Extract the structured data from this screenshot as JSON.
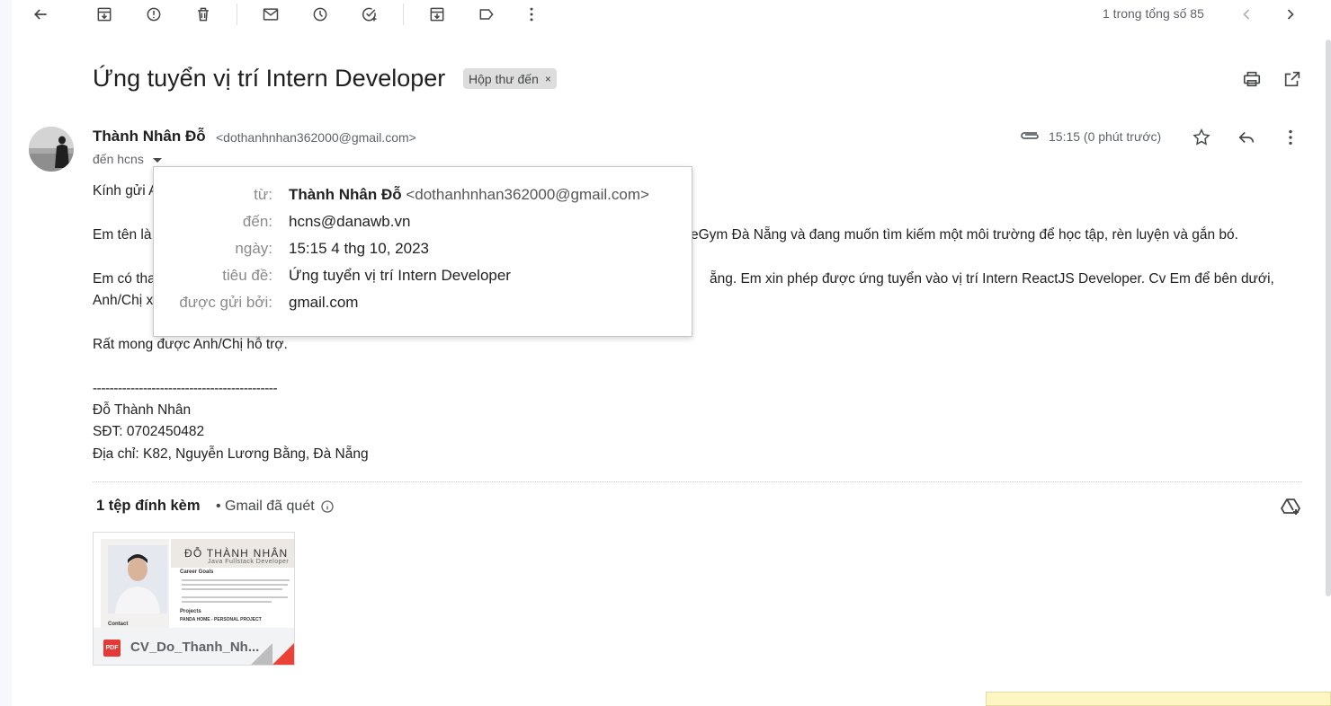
{
  "toolbar": {
    "back": "back-arrow-icon",
    "pager_text": "1 trong tổng số 85"
  },
  "subject": {
    "title": "Ứng tuyển vị trí Intern Developer",
    "label": "Hộp thư đến",
    "label_remove": "×"
  },
  "sender": {
    "name": "Thành Nhân Đỗ",
    "email": "<dothanhnhan362000@gmail.com>",
    "to": "đến hcns",
    "time": "15:15 (0 phút trước)"
  },
  "body": {
    "greeting": "Kính gửi A",
    "line1_start": "Em tên là",
    "line1_end": "eGym Đà Nẵng và đang muốn tìm kiếm một môi trường để học tập, rèn luyện và gắn bó.",
    "line2_start": "Em có tha",
    "line2_end": "ẵng. Em xin phép được ứng tuyển vào vị trí Intern ReactJS Developer. Cv Em để bên dưới,",
    "line3_start": "Anh/Chị x",
    "support": "Rất mong được Anh/Chị hỗ trợ.",
    "sig_divider": "--------------------------------------------",
    "sig_name": "Đỗ Thành Nhân",
    "sig_phone": "SĐT: 0702450482",
    "sig_address": "Địa chỉ: K82, Nguyễn Lương Bằng, Đà Nẵng"
  },
  "popup": {
    "from_label": "từ:",
    "from_name": "Thành Nhân Đỗ",
    "from_email": "<dothanhnhan362000@gmail.com>",
    "to_label": "đến:",
    "to_value": "hcns@danawb.vn",
    "date_label": "ngày:",
    "date_value": "15:15 4 thg 10, 2023",
    "subject_label": "tiêu đề:",
    "subject_value": "Ứng tuyển vị trí Intern Developer",
    "sent_by_label": "được gửi bởi:",
    "sent_by_value": "gmail.com"
  },
  "attachments": {
    "title": "1 tệp đính kèm",
    "scanned": "• Gmail đã quét",
    "items": [
      {
        "filename": "CV_Do_Thanh_Nh...",
        "type_badge": "PDF",
        "thumb_name": "ĐỖ THÀNH NHÂN",
        "thumb_role": "Java Fullstack Developer",
        "thumb_heading_goals": "Career Goals",
        "thumb_heading_projects": "Projects",
        "thumb_project": "PANDA HOME - PERSONAL PROJECT",
        "thumb_contact": "Contact"
      }
    ]
  },
  "colors": {
    "label_bg": "#dddddd",
    "accent_red": "#ea4335",
    "muted_text": "#5f6368"
  }
}
